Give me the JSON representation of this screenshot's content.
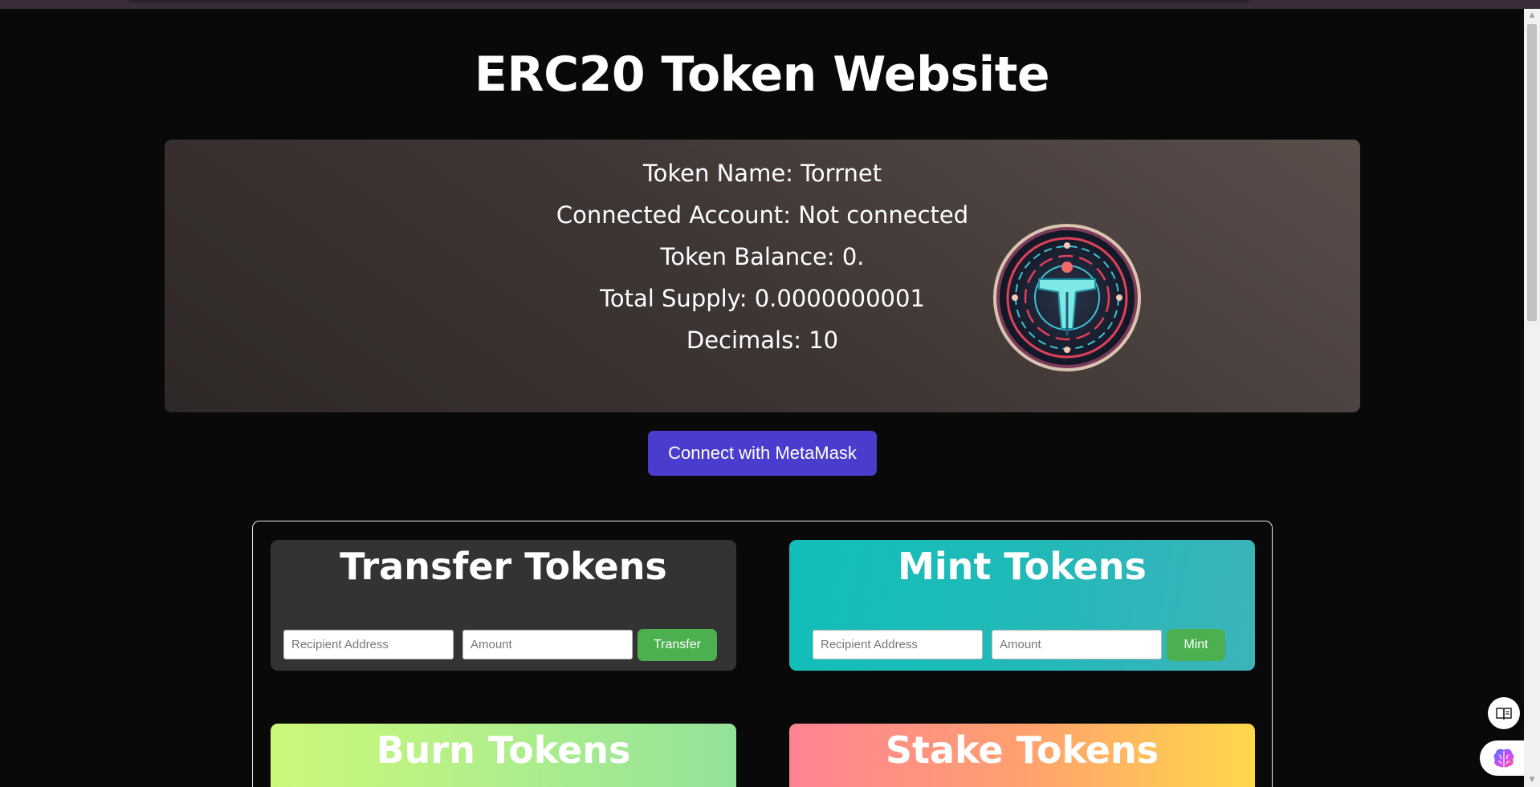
{
  "page": {
    "title": "ERC20 Token Website"
  },
  "token_info": {
    "name_line": "Token Name: Torrnet",
    "account_line": "Connected Account: Not connected",
    "balance_line": "Token Balance: 0.",
    "supply_line": "Total Supply: 0.0000000001",
    "decimals_line": "Decimals: 10",
    "logo_icon": "torrnet-token-logo"
  },
  "connect": {
    "label": "Connect with MetaMask",
    "color": "#4a3ccc"
  },
  "actions": {
    "transfer": {
      "title": "Transfer Tokens",
      "recipient_placeholder": "Recipient Address",
      "amount_placeholder": "Amount",
      "button_label": "Transfer"
    },
    "mint": {
      "title": "Mint Tokens",
      "recipient_placeholder": "Recipient Address",
      "amount_placeholder": "Amount",
      "button_label": "Mint"
    },
    "burn": {
      "title": "Burn Tokens"
    },
    "stake": {
      "title": "Stake Tokens"
    },
    "button_color": "#4caf50"
  },
  "floating": {
    "reader_icon": "book-icon",
    "assistant_icon": "brain-icon"
  }
}
